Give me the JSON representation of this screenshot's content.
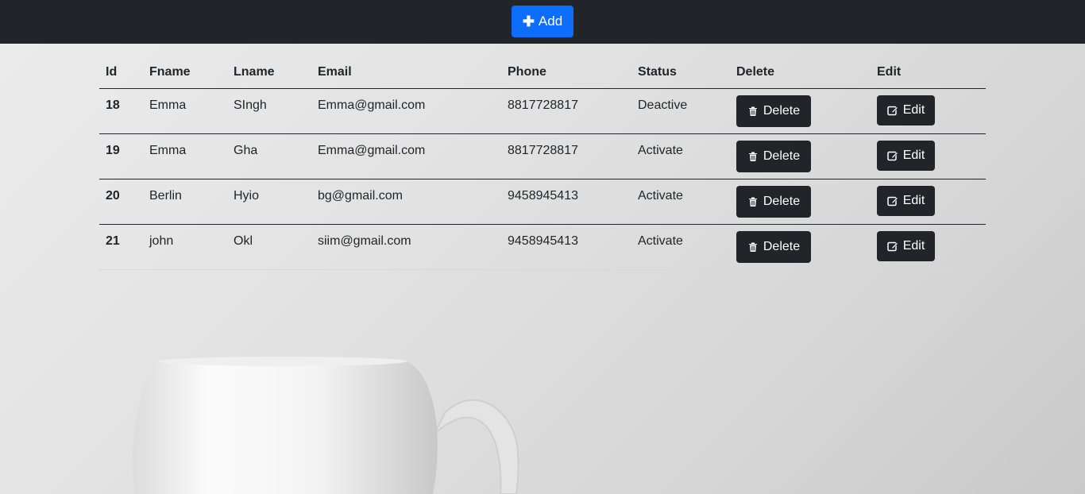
{
  "toolbar": {
    "add_label": "Add",
    "add_icon": "plus-icon",
    "accent": "#0d6efd",
    "bar_color": "#212529"
  },
  "table": {
    "headers": [
      "Id",
      "Fname",
      "Lname",
      "Email",
      "Phone",
      "Status",
      "Delete",
      "Edit"
    ],
    "rows": [
      {
        "id": "18",
        "fname": "Emma",
        "lname": "SIngh",
        "email": "Emma@gmail.com",
        "phone": "8817728817",
        "status": "Deactive",
        "delete": "Delete",
        "edit": "Edit"
      },
      {
        "id": "19",
        "fname": "Emma",
        "lname": "Gha",
        "email": "Emma@gmail.com",
        "phone": "8817728817",
        "status": "Activate",
        "delete": "Delete",
        "edit": "Edit"
      },
      {
        "id": "20",
        "fname": "Berlin",
        "lname": "Hyio",
        "email": "bg@gmail.com",
        "phone": "9458945413",
        "status": "Activate",
        "delete": "Delete",
        "edit": "Edit"
      },
      {
        "id": "21",
        "fname": "john",
        "lname": "Okl",
        "email": "siim@gmail.com",
        "phone": "9458945413",
        "status": "Activate",
        "delete": "Delete",
        "edit": "Edit"
      }
    ],
    "delete_icon": "trash-icon",
    "edit_icon": "edit-icon"
  }
}
